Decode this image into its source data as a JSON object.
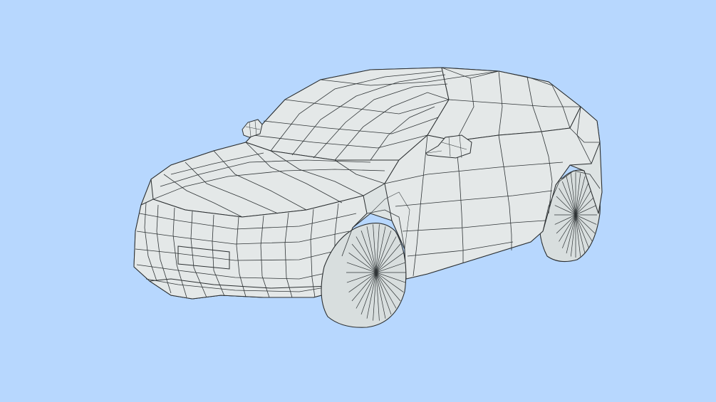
{
  "viewport": {
    "background_color": "#b7d7fe",
    "model_surface_color": "#dde3e3",
    "wireframe_color": "#2b2f31",
    "model": "car-wireframe"
  }
}
